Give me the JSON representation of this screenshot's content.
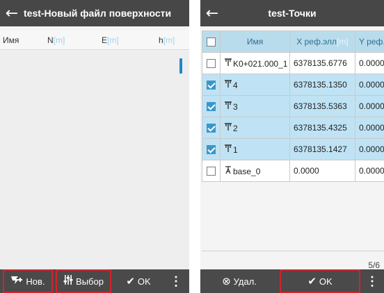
{
  "left": {
    "title": "test-Новый файл поверхности",
    "columns": [
      {
        "label": "Имя",
        "unit": ""
      },
      {
        "label": "N",
        "unit": "[m]"
      },
      {
        "label": "E",
        "unit": "[m]"
      },
      {
        "label": "h",
        "unit": "[m]"
      }
    ],
    "buttons": {
      "new_label": "Нов.",
      "select_label": "Выбор",
      "ok_label": "OK",
      "more_label": "⋮"
    }
  },
  "right": {
    "title": "test-Точки",
    "columns": [
      {
        "label": "Имя",
        "unit": ""
      },
      {
        "label": "X реф.элл",
        "unit": "[m]"
      },
      {
        "label": "Y реф.",
        "unit": ""
      }
    ],
    "rows": [
      {
        "checked": false,
        "icon": "survey-point-icon",
        "name": "K0+021.000_1",
        "x": "6378135.6776",
        "y": "0.0000"
      },
      {
        "checked": true,
        "icon": "survey-point-icon",
        "name": "4",
        "x": "6378135.1350",
        "y": "0.0000"
      },
      {
        "checked": true,
        "icon": "survey-point-icon",
        "name": "3",
        "x": "6378135.5363",
        "y": "0.0000"
      },
      {
        "checked": true,
        "icon": "survey-point-icon",
        "name": "2",
        "x": "6378135.4325",
        "y": "0.0000"
      },
      {
        "checked": true,
        "icon": "survey-point-icon",
        "name": "1",
        "x": "6378135.1427",
        "y": "0.0000"
      },
      {
        "checked": false,
        "icon": "base-station-icon",
        "name": "base_0",
        "x": "0.0000",
        "y": "0.0000"
      }
    ],
    "counter": "5/6",
    "buttons": {
      "delete_label": "Удал.",
      "ok_label": "OK",
      "more_label": "⋮"
    }
  },
  "colors": {
    "titlebar": "#474747",
    "header": "#b9dcec",
    "selected_row": "#bfe3f4",
    "checkbox": "#3b97c9",
    "highlight_box": "#d2242b"
  }
}
